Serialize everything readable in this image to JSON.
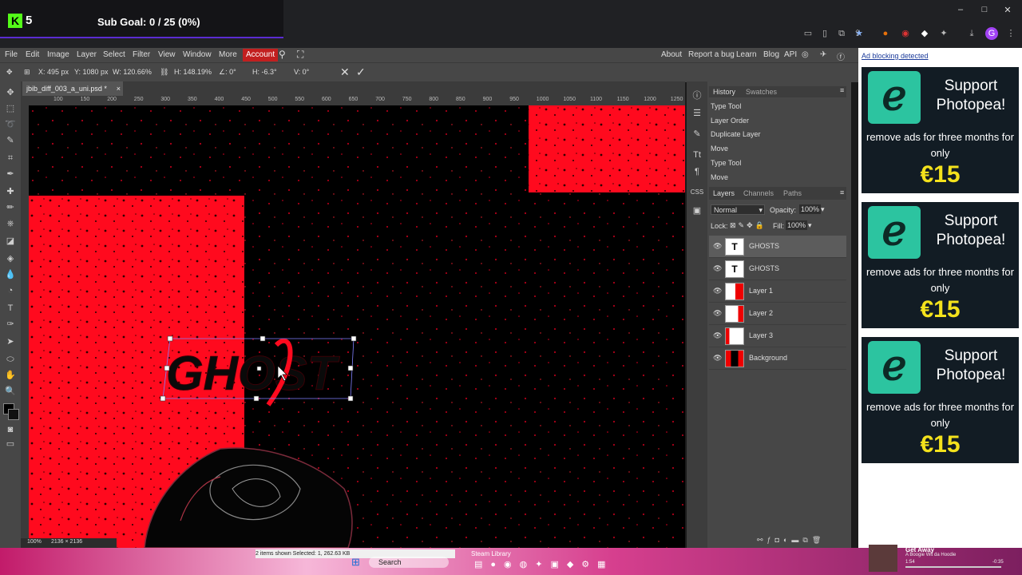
{
  "stream_overlay": {
    "logo_letter": "K",
    "count": "5",
    "sub_goal": "Sub Goal: 0 / 25 (0%)"
  },
  "window_controls": {
    "minimize": "–",
    "maximize": "□",
    "close": "✕"
  },
  "menu": {
    "items": [
      "File",
      "Edit",
      "Image",
      "Layer",
      "Select",
      "Filter",
      "View",
      "Window",
      "More"
    ],
    "account": "Account",
    "right_links": [
      "About",
      "Report a bug",
      "Learn",
      "Blog",
      "API"
    ]
  },
  "options_bar": {
    "x": "X: 495 px",
    "y": "Y: 1080 px",
    "w": "W: 120.66%",
    "h": "H: 148.19%",
    "angle": "∠: 0°",
    "skew_h": "H: -6.3°",
    "skew_v": "V: 0°"
  },
  "document_tab": {
    "name": "jbib_diff_003_a_uni.psd *",
    "close": "×"
  },
  "ruler_ticks": [
    "100",
    "150",
    "200",
    "250",
    "300",
    "350",
    "400",
    "450",
    "500",
    "550",
    "600",
    "650",
    "700",
    "750",
    "800",
    "850",
    "900",
    "950",
    "1000",
    "1050",
    "1100",
    "1150",
    "1200",
    "1250"
  ],
  "canvas": {
    "text_art": "GHOST",
    "colors": {
      "red": "#ff0a1e",
      "black": "#000000"
    }
  },
  "status_bar": {
    "zoom": "100%",
    "size": "2136 × 2136"
  },
  "history": {
    "tabs": [
      "History",
      "Swatches"
    ],
    "items": [
      "Type Tool",
      "Layer Order",
      "Duplicate Layer",
      "Move",
      "Type Tool",
      "Move"
    ]
  },
  "layers_panel": {
    "tabs": [
      "Layers",
      "Channels",
      "Paths"
    ],
    "blend_mode": "Normal",
    "opacity_label": "Opacity:",
    "opacity": "100%",
    "lock_label": "Lock:",
    "fill_label": "Fill:",
    "fill": "100%",
    "layers": [
      {
        "name": "GHOSTS",
        "type": "text",
        "thumb": "T"
      },
      {
        "name": "GHOSTS",
        "type": "text",
        "thumb": "T"
      },
      {
        "name": "Layer 1",
        "type": "raster",
        "thumb": ""
      },
      {
        "name": "Layer 2",
        "type": "raster",
        "thumb": ""
      },
      {
        "name": "Layer 3",
        "type": "raster",
        "thumb": ""
      },
      {
        "name": "Background",
        "type": "raster",
        "thumb": ""
      }
    ]
  },
  "ads": {
    "notice": "Ad blocking detected",
    "items": [
      {
        "title": "Support Photopea!",
        "text": "remove ads for three months for only",
        "price": "€15"
      },
      {
        "title": "Support Photopea!",
        "text": "remove ads for three months for only",
        "price": "€15"
      },
      {
        "title": "Support Photopea!",
        "text": "remove ads for three months for only",
        "price": "€15"
      }
    ]
  },
  "taskbar": {
    "explorer_status": "2 items shown   Selected: 1, 262.63 KB",
    "search": "Search",
    "steam": "Steam Library",
    "media_title": "Get Away",
    "media_artist": "A Boogie Wit da Hoodie",
    "media_time": "1:54",
    "media_remaining": "-0:35"
  }
}
